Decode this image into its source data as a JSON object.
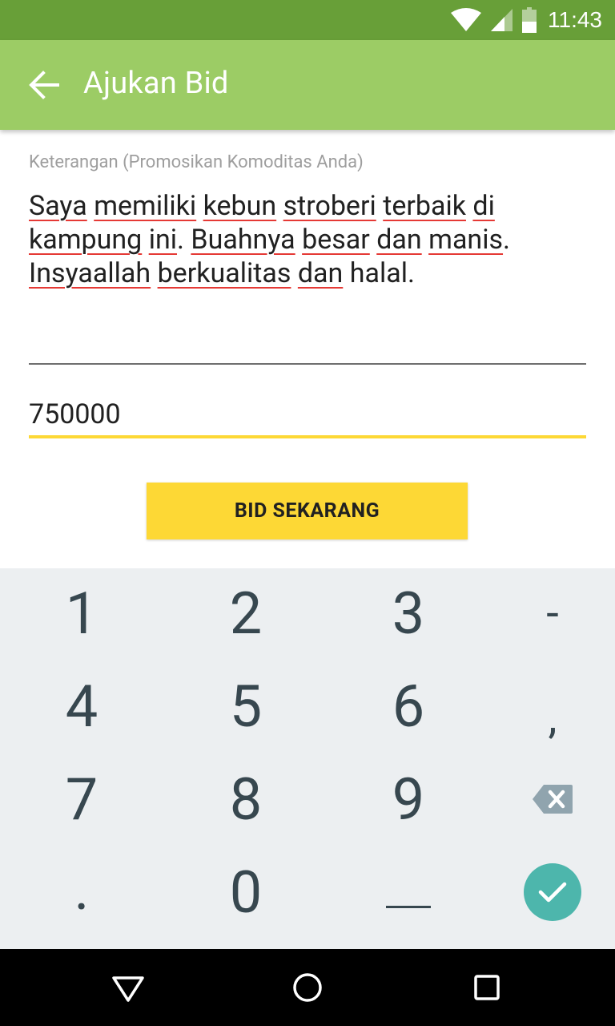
{
  "status_bar": {
    "time": "11:43",
    "icons": [
      "wifi-icon",
      "signal-icon",
      "battery-icon"
    ],
    "background": "#689f38"
  },
  "app_bar": {
    "title": "Ajukan Bid",
    "background": "#9ccc65"
  },
  "form": {
    "description_label": "Keterangan (Promosikan Komoditas Anda)",
    "description_value": "Saya memiliki kebun stroberi terbaik di kampung ini. Buahnya besar dan manis. Insyaallah berkualitas dan halal.",
    "price_value": "750000",
    "submit_label": "BID SEKARANG",
    "accent_color": "#fdd835"
  },
  "keyboard": {
    "rows": [
      [
        "1",
        "2",
        "3",
        "-"
      ],
      [
        "4",
        "5",
        "6",
        ","
      ],
      [
        "7",
        "8",
        "9",
        "backspace-icon"
      ],
      [
        ".",
        "0",
        "space-icon",
        "done-check-icon"
      ]
    ],
    "done_color": "#4db6ac"
  },
  "nav_bar": {
    "icons": [
      "back-triangle-icon",
      "home-circle-icon",
      "recents-square-icon"
    ]
  }
}
